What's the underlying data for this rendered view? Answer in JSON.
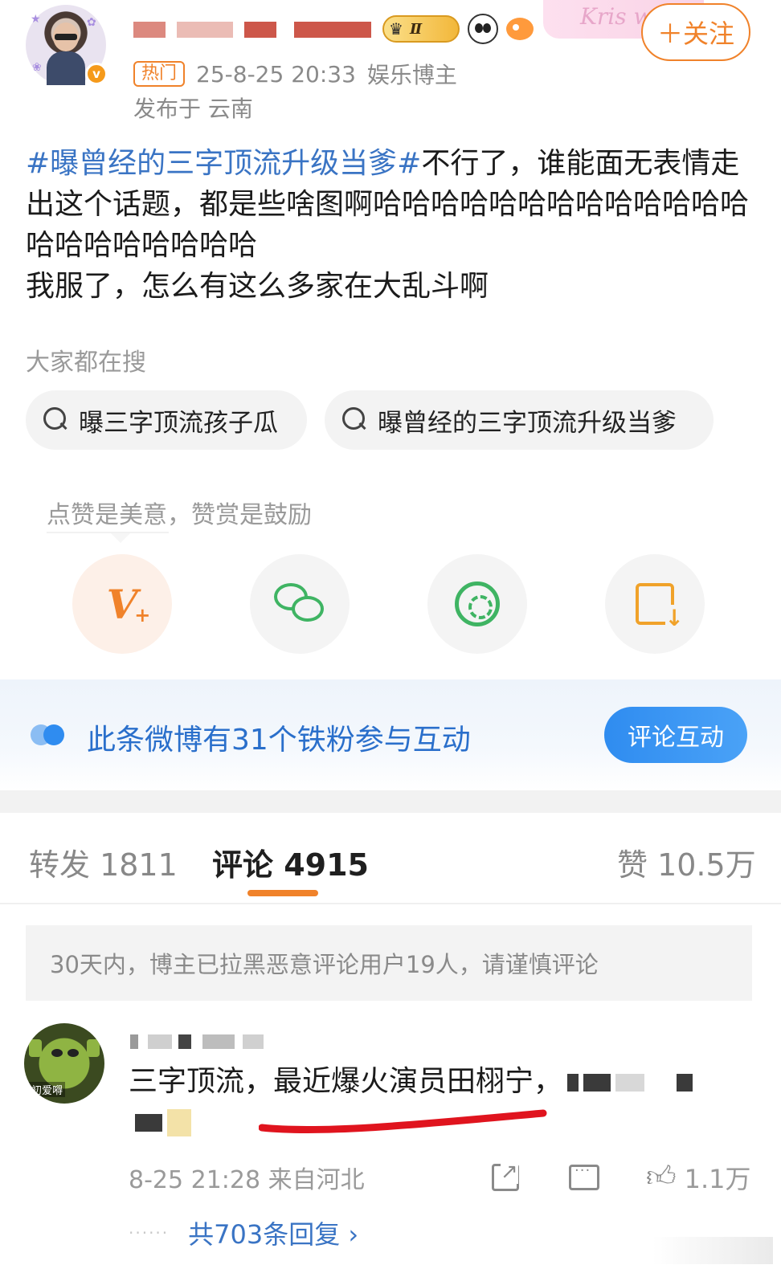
{
  "header": {
    "follow_label": "＋关注",
    "hot_tag": "热门",
    "timestamp": "25-8-25 20:33",
    "role": "娱乐博主",
    "location": "发布于 云南",
    "level_badge": "Ⅱ",
    "card_text": "Kris w"
  },
  "post": {
    "topic": "#曝曾经的三字顶流升级当爹#",
    "text_after_topic": "不行了，谁能面无表情走出这个话题，都是些啥图啊哈哈哈哈哈哈哈哈哈哈哈哈哈哈哈哈哈哈哈哈哈",
    "line2": "我服了，怎么有这么多家在大乱斗啊"
  },
  "search": {
    "title": "大家都在搜",
    "chips": [
      "曝三字顶流孩子瓜",
      "曝曾经的三字顶流升级当爹"
    ]
  },
  "reward_tip": "点赞是美意，赞赏是鼓励",
  "actions": [
    {
      "icon": "reward-v-plus-icon"
    },
    {
      "icon": "wechat-icon"
    },
    {
      "icon": "moments-icon"
    },
    {
      "icon": "save-image-icon"
    }
  ],
  "fans_banner": {
    "text": "此条微博有31个铁粉参与互动",
    "button": "评论互动"
  },
  "tabs": {
    "repost": "转发 1811",
    "comment": "评论 4915",
    "like": "赞 10.5万"
  },
  "notice": "30天内，博主已拉黑恶意评论用户19人，请谨慎评论",
  "comment": {
    "text": "三字顶流，最近爆火演员田栩宁，",
    "time_location": "8-25 21:28 来自河北",
    "like_count": "1.1万",
    "replies_link": "共703条回复 ›",
    "avatar_caption": "初爱嘚",
    "dots": "······"
  },
  "colors": {
    "accent_orange": "#f0822a",
    "topic_blue": "#3a74c4",
    "banner_blue": "#2f8cf0",
    "wechat_green": "#3fb463"
  }
}
